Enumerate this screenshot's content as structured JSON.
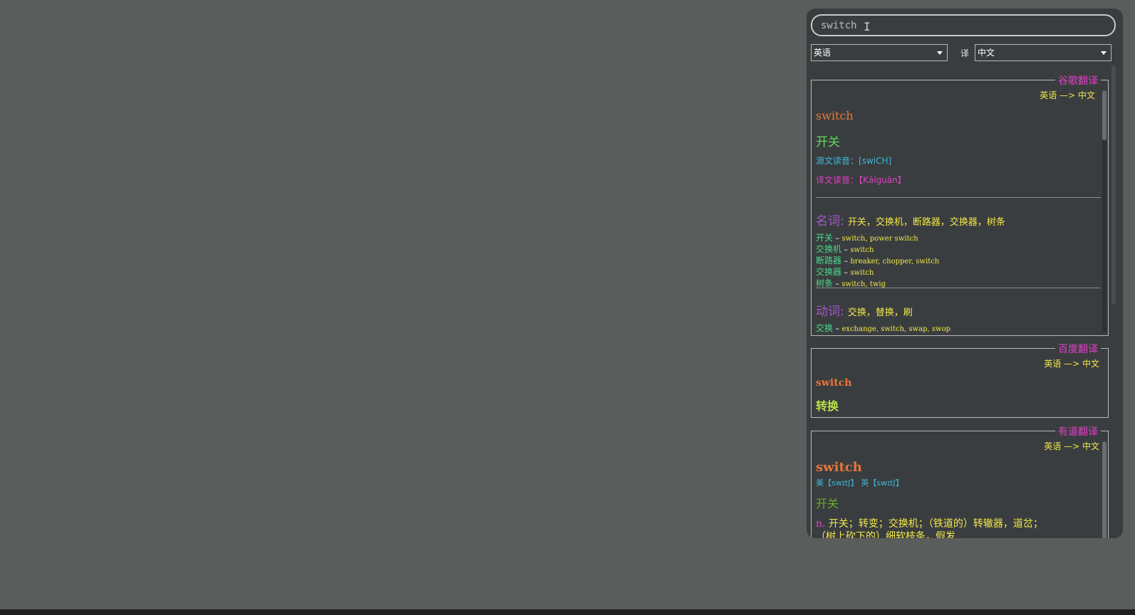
{
  "search": {
    "value": "switch"
  },
  "lang": {
    "source": "英语",
    "to_label": "译",
    "target": "中文"
  },
  "google": {
    "title": "谷歌翻译",
    "direction": "英语 —> 中文",
    "source_word": "switch",
    "translation": "开关",
    "src_pron_label": "源文读音：",
    "src_pron": "[swiCH]",
    "tgt_pron_label": "译文读音：",
    "tgt_pron": "【Kāiguān】",
    "noun_label": "名词:",
    "noun_list": "开关，交换机，断路器，交换器，树条",
    "noun_syn": [
      {
        "w": "开关",
        "e": "switch, power switch"
      },
      {
        "w": "交换机",
        "e": "switch"
      },
      {
        "w": "断路器",
        "e": "breaker, chopper, switch"
      },
      {
        "w": "交换器",
        "e": "switch"
      },
      {
        "w": "树条",
        "e": "switch, twig"
      }
    ],
    "verb_label": "动词:",
    "verb_list": "交换，替换，刷",
    "verb_syn": [
      {
        "w": "交换",
        "e": "exchange, switch, swap, swop"
      }
    ]
  },
  "baidu": {
    "title": "百度翻译",
    "direction": "英语 —> 中文",
    "source_word": "switch",
    "translation": "转换"
  },
  "youdao": {
    "title": "有道翻译",
    "direction": "英语 —> 中文",
    "source_word": "switch",
    "phonetic": "美【swɪtʃ】 英【swɪtʃ】",
    "translation": "开关",
    "pos": "n.",
    "def_line1": "开关；转变；交换机；（铁道的）转辙器，道岔；",
    "def_line2": "（树上砍下的）细软枝条，假发"
  },
  "colors": {
    "background": "#5a5d5c",
    "panel": "#3a3d3f",
    "title": "#e040c8",
    "source_word": "#e8763a",
    "translation": "#5cd85c",
    "direction": "#f2e84a"
  }
}
